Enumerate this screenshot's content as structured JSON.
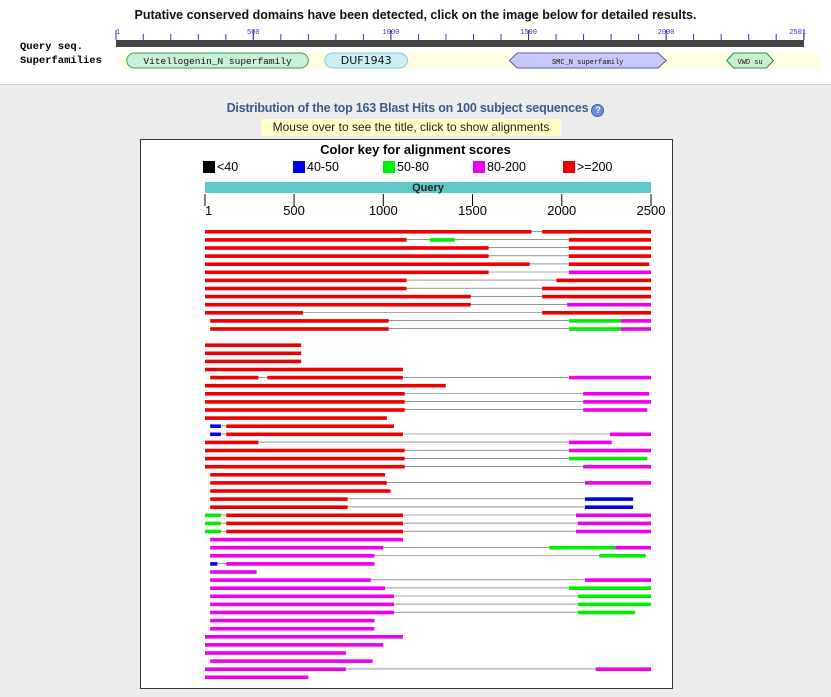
{
  "header": "Putative conserved domains have been detected, click on the image below for detailed results.",
  "query_seq_label": "Query seq.",
  "superfamilies_label": "Superfamilies",
  "ruler": {
    "min": 1,
    "max": 2501,
    "ticks": [
      1,
      500,
      1000,
      1500,
      2000,
      2501
    ]
  },
  "domains": [
    {
      "name": "Vitellogenin_N superfamily",
      "start": 40,
      "end": 700,
      "color": "#c8f0d8",
      "shape": "rounded"
    },
    {
      "name": "DUF1943",
      "start": 760,
      "end": 1060,
      "color": "#c8f0f4",
      "shape": "rounded"
    },
    {
      "name": "SMC_N superfamily",
      "start": 1430,
      "end": 2000,
      "color": "#c8c8f8",
      "shape": "arrow"
    },
    {
      "name": "VWD su",
      "start": 2220,
      "end": 2390,
      "color": "#c8f0d0",
      "shape": "diamond"
    }
  ],
  "distribution_title": "Distribution of the top 163 Blast Hits on 100 subject sequences",
  "mouse_hint": "Mouse over to see the title, click to show alignments",
  "color_key": {
    "title": "Color key for alignment scores",
    "items": [
      {
        "label": "<40",
        "color": "#000000"
      },
      {
        "label": "40-50",
        "color": "#0000ee"
      },
      {
        "label": "50-80",
        "color": "#00ee00"
      },
      {
        "label": "80-200",
        "color": "#ee00ee"
      },
      {
        "label": ">=200",
        "color": "#ee0000"
      }
    ]
  },
  "query_bar_label": "Query",
  "axis": {
    "min": 1,
    "max": 2500,
    "ticks": [
      1,
      500,
      1000,
      1500,
      2000,
      2500
    ]
  },
  "hits": [
    {
      "segs": [
        [
          1,
          1830,
          "r"
        ],
        [
          1890,
          2500,
          "r"
        ]
      ]
    },
    {
      "segs": [
        [
          1,
          1130,
          "r"
        ],
        [
          1260,
          1400,
          "g"
        ],
        [
          2040,
          2500,
          "r"
        ]
      ]
    },
    {
      "segs": [
        [
          1,
          1590,
          "r"
        ],
        [
          2040,
          2500,
          "r"
        ]
      ]
    },
    {
      "segs": [
        [
          1,
          1590,
          "r"
        ],
        [
          2040,
          2500,
          "r"
        ]
      ]
    },
    {
      "segs": [
        [
          1,
          1820,
          "r"
        ],
        [
          2040,
          2490,
          "r"
        ]
      ]
    },
    {
      "segs": [
        [
          1,
          1590,
          "r"
        ],
        [
          2040,
          2500,
          "m"
        ]
      ]
    },
    {
      "segs": [
        [
          1,
          1130,
          "r"
        ],
        [
          1970,
          2500,
          "r"
        ]
      ]
    },
    {
      "segs": [
        [
          1,
          1130,
          "r"
        ],
        [
          1890,
          2500,
          "r"
        ]
      ]
    },
    {
      "segs": [
        [
          1,
          1490,
          "r"
        ],
        [
          1890,
          2500,
          "r"
        ]
      ]
    },
    {
      "segs": [
        [
          1,
          1490,
          "r"
        ],
        [
          2030,
          2500,
          "m"
        ]
      ]
    },
    {
      "segs": [
        [
          1,
          550,
          "r"
        ],
        [
          1890,
          2500,
          "r"
        ]
      ]
    },
    {
      "segs": [
        [
          30,
          1030,
          "r"
        ],
        [
          2040,
          2330,
          "g"
        ],
        [
          2330,
          2500,
          "m"
        ]
      ]
    },
    {
      "segs": [
        [
          30,
          1030,
          "r"
        ],
        [
          2040,
          2330,
          "g"
        ],
        [
          2330,
          2500,
          "m"
        ]
      ]
    },
    {
      "segs": []
    },
    {
      "segs": [
        [
          1,
          540,
          "r"
        ]
      ]
    },
    {
      "segs": [
        [
          1,
          540,
          "r"
        ]
      ]
    },
    {
      "segs": [
        [
          1,
          540,
          "r"
        ]
      ]
    },
    {
      "segs": [
        [
          1,
          1110,
          "r"
        ]
      ]
    },
    {
      "segs": [
        [
          30,
          300,
          "r"
        ],
        [
          350,
          1110,
          "r"
        ],
        [
          2040,
          2500,
          "m"
        ]
      ]
    },
    {
      "segs": [
        [
          1,
          1350,
          "r"
        ]
      ]
    },
    {
      "segs": [
        [
          1,
          1120,
          "r"
        ],
        [
          2120,
          2490,
          "m"
        ]
      ]
    },
    {
      "segs": [
        [
          1,
          1120,
          "r"
        ],
        [
          2120,
          2500,
          "m"
        ]
      ]
    },
    {
      "segs": [
        [
          1,
          1120,
          "r"
        ],
        [
          2120,
          2480,
          "m"
        ]
      ]
    },
    {
      "segs": [
        [
          1,
          1020,
          "r"
        ]
      ]
    },
    {
      "segs": [
        [
          30,
          90,
          "b"
        ],
        [
          120,
          1060,
          "r"
        ]
      ]
    },
    {
      "segs": [
        [
          30,
          90,
          "b"
        ],
        [
          120,
          1110,
          "r"
        ],
        [
          2270,
          2500,
          "m"
        ]
      ]
    },
    {
      "segs": [
        [
          1,
          300,
          "r"
        ],
        [
          2040,
          2280,
          "m"
        ]
      ]
    },
    {
      "segs": [
        [
          1,
          1120,
          "r"
        ],
        [
          2040,
          2500,
          "m"
        ]
      ]
    },
    {
      "segs": [
        [
          1,
          1120,
          "r"
        ],
        [
          2040,
          2480,
          "g"
        ]
      ]
    },
    {
      "segs": [
        [
          1,
          1120,
          "r"
        ],
        [
          2120,
          2500,
          "m"
        ]
      ]
    },
    {
      "segs": [
        [
          30,
          1010,
          "r"
        ]
      ]
    },
    {
      "segs": [
        [
          30,
          1020,
          "r"
        ],
        [
          2130,
          2500,
          "m"
        ]
      ]
    },
    {
      "segs": [
        [
          30,
          1040,
          "r"
        ]
      ]
    },
    {
      "segs": [
        [
          30,
          800,
          "r"
        ],
        [
          2130,
          2400,
          "b"
        ]
      ]
    },
    {
      "segs": [
        [
          30,
          800,
          "r"
        ],
        [
          2130,
          2400,
          "b"
        ]
      ]
    },
    {
      "segs": [
        [
          1,
          90,
          "g"
        ],
        [
          120,
          1110,
          "r"
        ],
        [
          2080,
          2500,
          "m"
        ]
      ]
    },
    {
      "segs": [
        [
          1,
          90,
          "g"
        ],
        [
          120,
          1110,
          "r"
        ],
        [
          2090,
          2500,
          "m"
        ]
      ]
    },
    {
      "segs": [
        [
          1,
          90,
          "g"
        ],
        [
          120,
          1110,
          "r"
        ],
        [
          2080,
          2500,
          "m"
        ]
      ]
    },
    {
      "segs": [
        [
          30,
          1110,
          "m"
        ]
      ]
    },
    {
      "segs": [
        [
          30,
          1000,
          "m"
        ],
        [
          1930,
          2300,
          "g"
        ],
        [
          2300,
          2500,
          "m"
        ]
      ]
    },
    {
      "segs": [
        [
          30,
          950,
          "m"
        ],
        [
          2210,
          2470,
          "g"
        ]
      ]
    },
    {
      "segs": [
        [
          30,
          70,
          "b"
        ],
        [
          120,
          950,
          "m"
        ]
      ]
    },
    {
      "segs": [
        [
          30,
          290,
          "m"
        ]
      ]
    },
    {
      "segs": [
        [
          30,
          930,
          "m"
        ],
        [
          2130,
          2500,
          "m"
        ]
      ]
    },
    {
      "segs": [
        [
          30,
          1010,
          "m"
        ],
        [
          2040,
          2500,
          "g"
        ]
      ]
    },
    {
      "segs": [
        [
          30,
          1060,
          "m"
        ],
        [
          2090,
          2500,
          "g"
        ]
      ]
    },
    {
      "segs": [
        [
          30,
          1060,
          "m"
        ],
        [
          2090,
          2500,
          "g"
        ]
      ]
    },
    {
      "segs": [
        [
          30,
          1060,
          "m"
        ],
        [
          2090,
          2410,
          "g"
        ]
      ]
    },
    {
      "segs": [
        [
          30,
          950,
          "m"
        ]
      ]
    },
    {
      "segs": [
        [
          30,
          950,
          "m"
        ]
      ]
    },
    {
      "segs": [
        [
          1,
          1110,
          "m"
        ]
      ]
    },
    {
      "segs": [
        [
          1,
          1000,
          "m"
        ]
      ]
    },
    {
      "segs": [
        [
          1,
          790,
          "m"
        ]
      ]
    },
    {
      "segs": [
        [
          30,
          940,
          "m"
        ]
      ]
    },
    {
      "segs": [
        [
          1,
          790,
          "m"
        ],
        [
          2190,
          2500,
          "m"
        ]
      ]
    },
    {
      "segs": [
        [
          1,
          580,
          "m"
        ]
      ]
    }
  ]
}
